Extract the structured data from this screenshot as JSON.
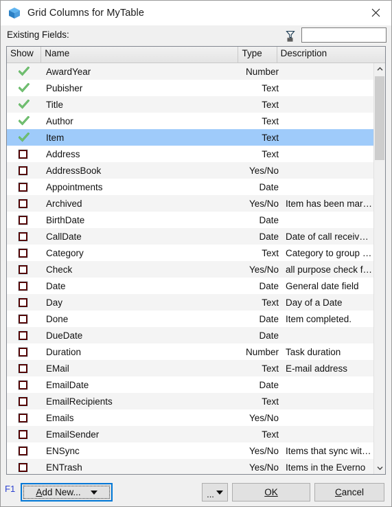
{
  "window": {
    "title": "Grid Columns for MyTable",
    "icon": "cube-icon",
    "close_label": "×"
  },
  "filterbar": {
    "label": "Existing Fields:",
    "filter_icon": "funnel-filter-icon",
    "filter_value": "",
    "filter_placeholder": ""
  },
  "grid": {
    "columns": [
      "Show",
      "Name",
      "Type",
      "Description"
    ],
    "rows": [
      {
        "show": true,
        "name": "AwardYear",
        "type": "Number",
        "description": "",
        "selected": false
      },
      {
        "show": true,
        "name": "Pubisher",
        "type": "Text",
        "description": "",
        "selected": false
      },
      {
        "show": true,
        "name": "Title",
        "type": "Text",
        "description": "",
        "selected": false
      },
      {
        "show": true,
        "name": "Author",
        "type": "Text",
        "description": "",
        "selected": false
      },
      {
        "show": true,
        "name": "Item",
        "type": "Text",
        "description": "",
        "selected": true
      },
      {
        "show": false,
        "name": "Address",
        "type": "Text",
        "description": "",
        "selected": false
      },
      {
        "show": false,
        "name": "AddressBook",
        "type": "Yes/No",
        "description": "",
        "selected": false
      },
      {
        "show": false,
        "name": "Appointments",
        "type": "Date",
        "description": "",
        "selected": false
      },
      {
        "show": false,
        "name": "Archived",
        "type": "Yes/No",
        "description": "Item has been mar…",
        "selected": false
      },
      {
        "show": false,
        "name": "BirthDate",
        "type": "Date",
        "description": "",
        "selected": false
      },
      {
        "show": false,
        "name": "CallDate",
        "type": "Date",
        "description": "Date of call receiv…",
        "selected": false
      },
      {
        "show": false,
        "name": "Category",
        "type": "Text",
        "description": "Category to group …",
        "selected": false
      },
      {
        "show": false,
        "name": "Check",
        "type": "Yes/No",
        "description": "all purpose check f…",
        "selected": false
      },
      {
        "show": false,
        "name": "Date",
        "type": "Date",
        "description": "General date field",
        "selected": false
      },
      {
        "show": false,
        "name": "Day",
        "type": "Text",
        "description": "Day of a Date",
        "selected": false
      },
      {
        "show": false,
        "name": "Done",
        "type": "Date",
        "description": "Item completed.",
        "selected": false
      },
      {
        "show": false,
        "name": "DueDate",
        "type": "Date",
        "description": "",
        "selected": false
      },
      {
        "show": false,
        "name": "Duration",
        "type": "Number",
        "description": "Task duration",
        "selected": false
      },
      {
        "show": false,
        "name": "EMail",
        "type": "Text",
        "description": "E-mail address",
        "selected": false
      },
      {
        "show": false,
        "name": "EmailDate",
        "type": "Date",
        "description": "",
        "selected": false
      },
      {
        "show": false,
        "name": "EmailRecipients",
        "type": "Text",
        "description": "",
        "selected": false
      },
      {
        "show": false,
        "name": "Emails",
        "type": "Yes/No",
        "description": "",
        "selected": false
      },
      {
        "show": false,
        "name": "EmailSender",
        "type": "Text",
        "description": "",
        "selected": false
      },
      {
        "show": false,
        "name": "ENSync",
        "type": "Yes/No",
        "description": "Items that sync wit…",
        "selected": false
      },
      {
        "show": false,
        "name": "ENTrash",
        "type": "Yes/No",
        "description": "Items in the Everno",
        "selected": false
      }
    ],
    "scrollbar": {
      "up_arrow": "chevron-up-icon",
      "down_arrow": "chevron-down-icon"
    }
  },
  "footer": {
    "shortcut_label": "F1",
    "add_new_label": "Add New...",
    "ellipsis_label": "...",
    "ok_label": "OK",
    "cancel_label": "Cancel"
  },
  "colors": {
    "selection": "#9fcbfa",
    "focus_border": "#0078d7",
    "shortcut_text": "#2c41d0",
    "checkbox_border": "#520000",
    "check_green": "#5eb45e"
  }
}
